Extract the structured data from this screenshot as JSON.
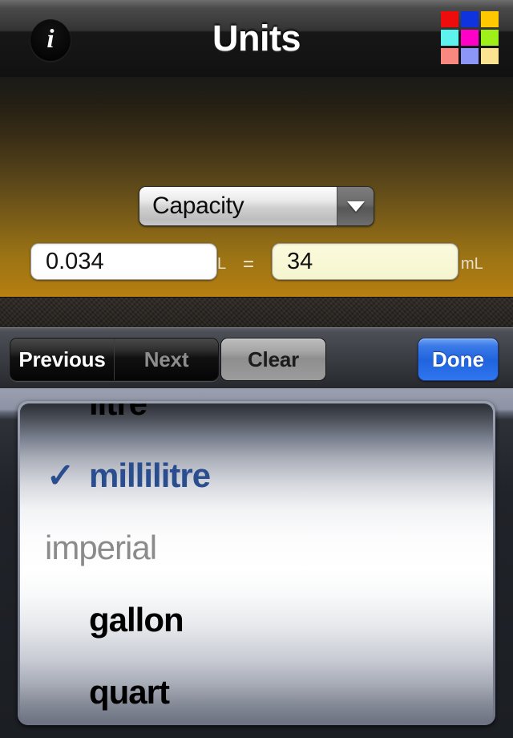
{
  "navbar": {
    "title": "Units",
    "info_icon": "info-icon",
    "info_glyph": "i",
    "color_grid_icon": "color-grid-icon",
    "color_grid": [
      "#ee0c0c",
      "#1033e0",
      "#ffc800",
      "#5ef2ee",
      "#ff00c8",
      "#9ef018",
      "#f88880",
      "#8c96f8",
      "#fce391"
    ]
  },
  "panel": {
    "category": {
      "label": "Capacity",
      "arrow_icon": "chevron-down-icon"
    },
    "from_value": "0.034",
    "from_symbol": "L",
    "equals": "=",
    "to_value": "34",
    "to_symbol": "mL",
    "from_unit": {
      "label": "litre",
      "arrow_icon": "chevron-down-icon"
    },
    "to_unit": {
      "label": "millilitre",
      "arrow_icon": "chevron-down-icon"
    },
    "swap_icon": "swap-horizontal-icon",
    "swap_glyph": "↔"
  },
  "toolbar": {
    "previous_label": "Previous",
    "next_label": "Next",
    "clear_label": "Clear",
    "done_label": "Done"
  },
  "picker": {
    "check_glyph": "✓",
    "rows": [
      {
        "label": "litre",
        "type": "item",
        "selected": false
      },
      {
        "label": "millilitre",
        "type": "item",
        "selected": true
      },
      {
        "label": "imperial",
        "type": "header",
        "selected": false
      },
      {
        "label": "gallon",
        "type": "item",
        "selected": false
      },
      {
        "label": "quart",
        "type": "item",
        "selected": false
      }
    ]
  },
  "colors": {
    "accent_blue": "#2a4d8f",
    "done_blue": "#2064dd",
    "panel_orange": "#b07c12",
    "field_cream": "#fbfbdd"
  }
}
